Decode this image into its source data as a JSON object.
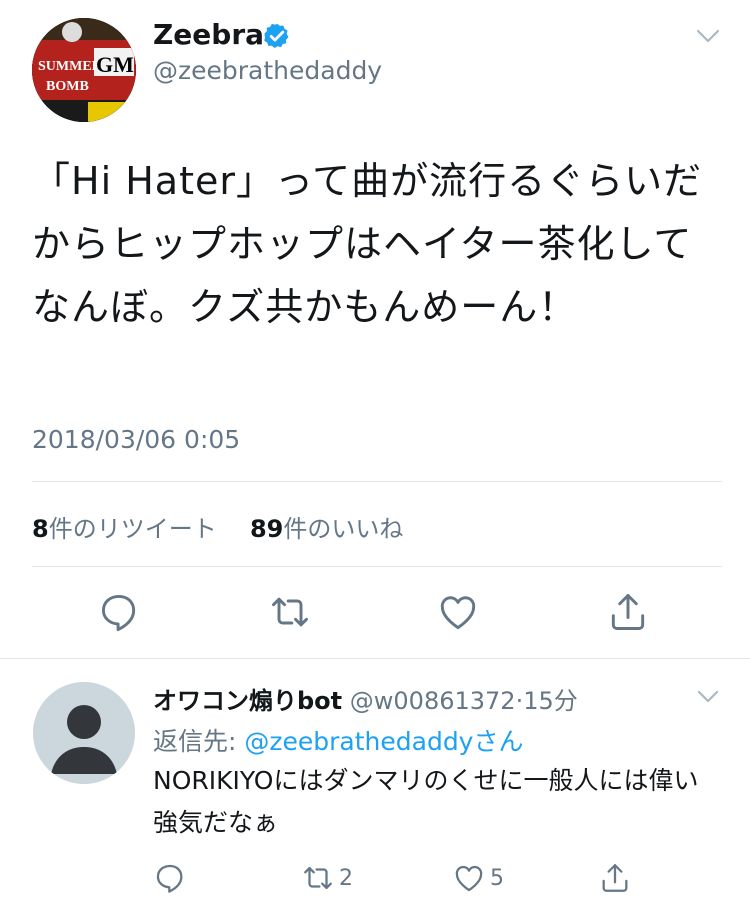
{
  "tweet": {
    "author_name": "Zeebra",
    "author_handle": "@zeebrathedaddy",
    "avatar_text": [
      "SUMMER",
      "BOMB",
      "GM"
    ],
    "text": "「Hi Hater」って曲が流行るぐらいだからヒップホップはヘイター茶化してなんぼ。クズ共かもんめーん！",
    "timestamp": "2018/03/06 0:05",
    "retweet_count": "8",
    "retweet_label": "件のリツイート",
    "like_count": "89",
    "like_label": "件のいいね"
  },
  "reply": {
    "author_name": "オワコン煽りbot",
    "author_handle": "@w00861372",
    "separator": "·",
    "time": "15分",
    "reply_to_label": "返信先: ",
    "reply_to_handle": "@zeebrathedaddy",
    "reply_to_suffix": "さん",
    "text": "NORIKIYOにはダンマリのくせに一般人には偉い強気だなぁ",
    "retweet_count": "2",
    "like_count": "5"
  },
  "icons": {
    "verified": "verified-badge-icon",
    "caret": "chevron-down-icon",
    "reply": "reply-bubble-icon",
    "retweet": "retweet-icon",
    "like": "heart-icon",
    "share": "share-icon"
  },
  "colors": {
    "accent": "#1da1f2",
    "secondary_text": "#657786",
    "primary_text": "#14171a"
  }
}
